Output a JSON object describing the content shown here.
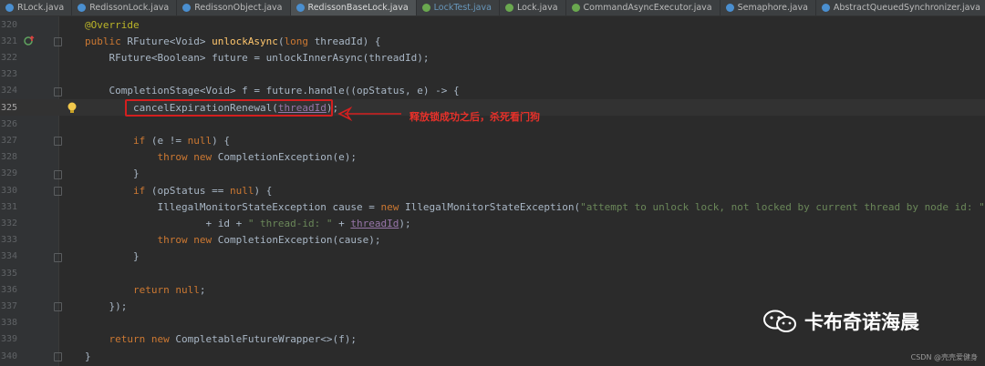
{
  "tabs": [
    {
      "label": "RLock.java",
      "color": "#4a8fd0",
      "active": false,
      "linked": false
    },
    {
      "label": "RedissonLock.java",
      "color": "#4a8fd0",
      "active": false,
      "linked": false
    },
    {
      "label": "RedissonObject.java",
      "color": "#4a8fd0",
      "active": false,
      "linked": false
    },
    {
      "label": "RedissonBaseLock.java",
      "color": "#4a8fd0",
      "active": true,
      "linked": false
    },
    {
      "label": "LockTest.java",
      "color": "#6aa84f",
      "active": false,
      "linked": true
    },
    {
      "label": "Lock.java",
      "color": "#6aa84f",
      "active": false,
      "linked": false
    },
    {
      "label": "CommandAsyncExecutor.java",
      "color": "#6aa84f",
      "active": false,
      "linked": false
    },
    {
      "label": "Semaphore.java",
      "color": "#4a8fd0",
      "active": false,
      "linked": false
    },
    {
      "label": "AbstractQueuedSynchronizer.java",
      "color": "#4a8fd0",
      "active": false,
      "linked": false
    }
  ],
  "lines": [
    {
      "num": "320",
      "tokens": [
        [
          "an",
          "@Override"
        ]
      ]
    },
    {
      "num": "321",
      "tokens": [
        [
          "kw",
          "public "
        ],
        [
          "t",
          "RFuture<Void> "
        ],
        [
          "fn",
          "unlockAsync"
        ],
        [
          "t",
          "("
        ],
        [
          "kw",
          "long "
        ],
        [
          "t",
          "threadId) {"
        ]
      ]
    },
    {
      "num": "322",
      "tokens": [
        [
          "t",
          "    RFuture<Boolean> future = unlockInnerAsync(threadId);"
        ]
      ]
    },
    {
      "num": "323",
      "tokens": []
    },
    {
      "num": "324",
      "tokens": [
        [
          "t",
          "    CompletionStage<Void> f = future.handle((opStatus, e) -> {"
        ]
      ]
    },
    {
      "num": "325",
      "tokens": [
        [
          "t",
          "        cancelExpirationRenewal("
        ],
        [
          "pu",
          "threadId"
        ],
        [
          "t",
          ");"
        ]
      ],
      "current": true
    },
    {
      "num": "326",
      "tokens": []
    },
    {
      "num": "327",
      "tokens": [
        [
          "t",
          "        "
        ],
        [
          "kw",
          "if "
        ],
        [
          "t",
          "(e != "
        ],
        [
          "kw",
          "null"
        ],
        [
          "t",
          ") {"
        ]
      ]
    },
    {
      "num": "328",
      "tokens": [
        [
          "t",
          "            "
        ],
        [
          "kw",
          "throw new "
        ],
        [
          "t",
          "CompletionException(e);"
        ]
      ]
    },
    {
      "num": "329",
      "tokens": [
        [
          "t",
          "        }"
        ]
      ]
    },
    {
      "num": "330",
      "tokens": [
        [
          "t",
          "        "
        ],
        [
          "kw",
          "if "
        ],
        [
          "t",
          "(opStatus == "
        ],
        [
          "kw",
          "null"
        ],
        [
          "t",
          ") {"
        ]
      ]
    },
    {
      "num": "331",
      "tokens": [
        [
          "t",
          "            IllegalMonitorStateException cause = "
        ],
        [
          "kw",
          "new "
        ],
        [
          "t",
          "IllegalMonitorStateException("
        ],
        [
          "st",
          "\"attempt to unlock lock, not locked by current thread by node id: \""
        ]
      ]
    },
    {
      "num": "332",
      "tokens": [
        [
          "t",
          "                    + id + "
        ],
        [
          "st",
          "\" thread-id: \""
        ],
        [
          "t",
          " + "
        ],
        [
          "pu",
          "threadId"
        ],
        [
          "t",
          ");"
        ]
      ]
    },
    {
      "num": "333",
      "tokens": [
        [
          "t",
          "            "
        ],
        [
          "kw",
          "throw new "
        ],
        [
          "t",
          "CompletionException(cause);"
        ]
      ]
    },
    {
      "num": "334",
      "tokens": [
        [
          "t",
          "        }"
        ]
      ]
    },
    {
      "num": "335",
      "tokens": []
    },
    {
      "num": "336",
      "tokens": [
        [
          "t",
          "        "
        ],
        [
          "kw",
          "return null"
        ],
        [
          "t",
          ";"
        ]
      ]
    },
    {
      "num": "337",
      "tokens": [
        [
          "t",
          "    });"
        ]
      ]
    },
    {
      "num": "338",
      "tokens": []
    },
    {
      "num": "339",
      "tokens": [
        [
          "t",
          "    "
        ],
        [
          "kw",
          "return new "
        ],
        [
          "t",
          "CompletableFutureWrapper<>(f);"
        ]
      ]
    },
    {
      "num": "340",
      "tokens": [
        [
          "t",
          "}"
        ]
      ]
    }
  ],
  "annotation": {
    "text": "释放锁成功之后，杀死看门狗",
    "color": "#e8312a"
  },
  "watermark": {
    "text": "卡布奇诺海晨"
  },
  "credit": {
    "text": "CSDN @壳壳爱健身"
  }
}
